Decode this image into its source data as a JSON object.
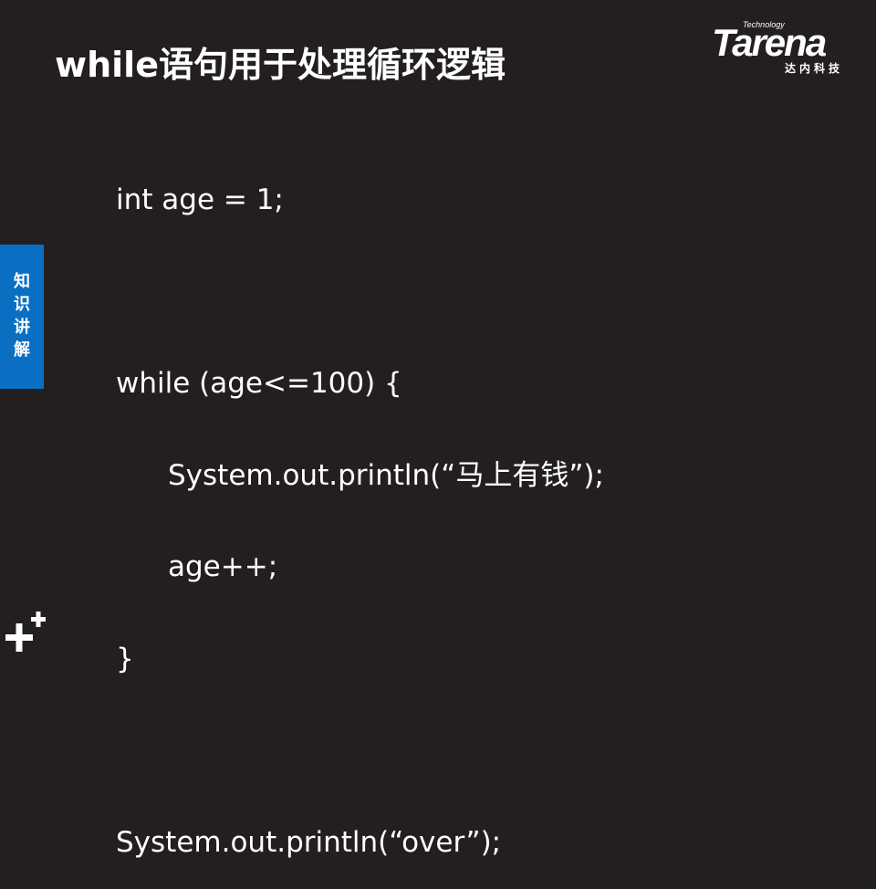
{
  "slide": {
    "title": "while语句用于处理循环逻辑",
    "side_tab": "知\n识\n讲\n解"
  },
  "logo": {
    "technology": "Technology",
    "name": "Tarena",
    "subtitle": "达内科技"
  },
  "code": {
    "line1": "int age = 1;",
    "line2": "",
    "line3": "while (age<=100) {",
    "line4": "System.out.println(“马上有钱”);",
    "line5": "age++;",
    "line6": "}",
    "line7": "",
    "line8": "System.out.println(“over”);"
  },
  "colors": {
    "background": "#231f20",
    "accent": "#0a6fc2",
    "text": "#ffffff"
  },
  "icons": {
    "corner_mark": "plus-plus-icon"
  }
}
